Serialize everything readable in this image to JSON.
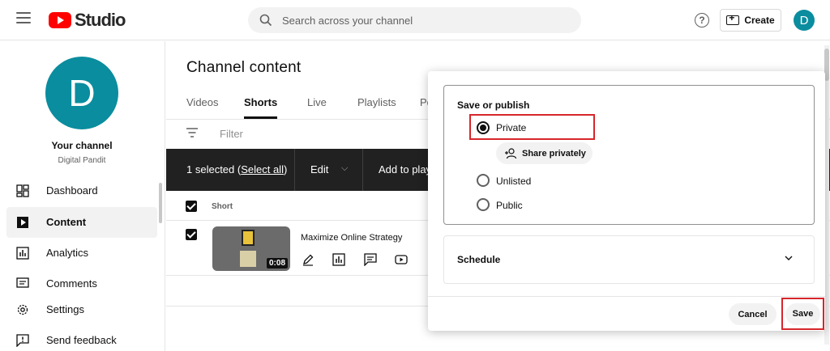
{
  "app": {
    "logo_text": "Studio",
    "brand_color": "#ff0000",
    "avatar_initial": "D",
    "avatar_color": "#0a8d9e"
  },
  "header": {
    "search_placeholder": "Search across your channel",
    "create_label": "Create",
    "help_glyph": "?"
  },
  "sidebar": {
    "your_channel": "Your channel",
    "channel_name": "Digital Pandit",
    "items": [
      {
        "label": "Dashboard",
        "icon": "dashboard-icon",
        "active": false
      },
      {
        "label": "Content",
        "icon": "content-icon",
        "active": true
      },
      {
        "label": "Analytics",
        "icon": "analytics-icon",
        "active": false
      },
      {
        "label": "Comments",
        "icon": "comments-icon",
        "active": false
      },
      {
        "label": "Settings",
        "icon": "gear-icon",
        "active": false
      },
      {
        "label": "Send feedback",
        "icon": "feedback-icon",
        "active": false
      }
    ]
  },
  "main": {
    "title": "Channel content",
    "tabs": [
      {
        "label": "Videos"
      },
      {
        "label": "Shorts"
      },
      {
        "label": "Live"
      },
      {
        "label": "Playlists"
      },
      {
        "label": "Po"
      }
    ],
    "active_tab": "Shorts",
    "filter_label": "Filter",
    "action_bar": {
      "selected_prefix": "1 selected (",
      "select_all": "Select all",
      "selected_suffix": ")",
      "edit": "Edit",
      "add_to": "Add to play"
    },
    "table": {
      "header_short": "Short",
      "rows": [
        {
          "title": "Maximize Online Strategy",
          "duration": "0:08",
          "selected": true
        }
      ]
    }
  },
  "popup": {
    "publish_title": "Save or publish",
    "options": [
      {
        "label": "Private",
        "selected": true
      },
      {
        "label": "Unlisted",
        "selected": false
      },
      {
        "label": "Public",
        "selected": false
      }
    ],
    "share_privately": "Share privately",
    "schedule_label": "Schedule",
    "cancel_label": "Cancel",
    "save_label": "Save",
    "highlight_color": "#d7262b"
  }
}
